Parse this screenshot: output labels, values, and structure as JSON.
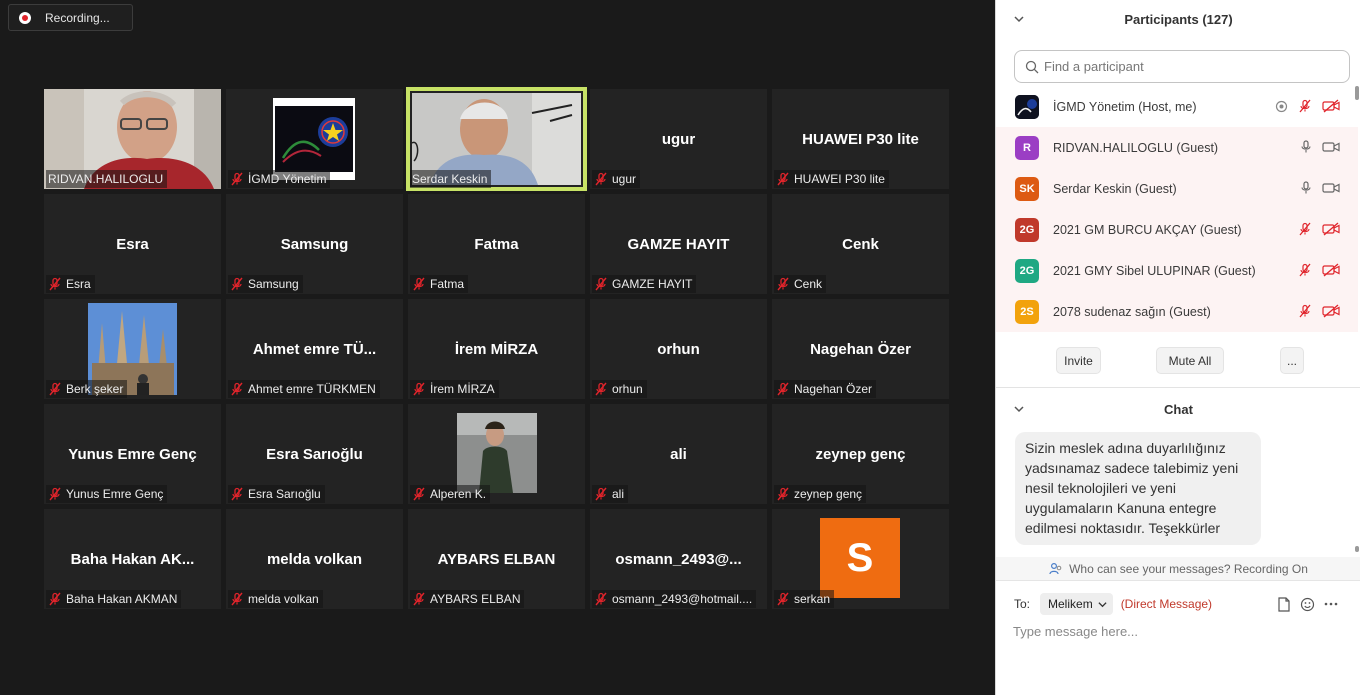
{
  "recording": {
    "label": "Recording..."
  },
  "tiles": [
    {
      "title": "",
      "label": "RIDVAN.HALILOGLU",
      "muted": false,
      "media": "photo-man-glasses",
      "active": false
    },
    {
      "title": "",
      "label": "İGMD Yönetim",
      "muted": true,
      "media": "logo",
      "active": false
    },
    {
      "title": "",
      "label": "Serdar Keskin",
      "muted": false,
      "media": "photo-man-speaking",
      "active": true
    },
    {
      "title": "ugur",
      "label": "ugur",
      "muted": true,
      "media": "",
      "active": false
    },
    {
      "title": "HUAWEI P30 lite",
      "label": "HUAWEI P30 lite",
      "muted": true,
      "media": "",
      "active": false
    },
    {
      "title": "Esra",
      "label": "Esra",
      "muted": true,
      "media": "",
      "active": false
    },
    {
      "title": "Samsung",
      "label": "Samsung",
      "muted": true,
      "media": "",
      "active": false
    },
    {
      "title": "Fatma",
      "label": "Fatma",
      "muted": true,
      "media": "",
      "active": false
    },
    {
      "title": "GAMZE HAYIT",
      "label": "GAMZE HAYIT",
      "muted": true,
      "media": "",
      "active": false
    },
    {
      "title": "Cenk",
      "label": "Cenk",
      "muted": true,
      "media": "",
      "active": false
    },
    {
      "title": "",
      "label": "Berk şeker",
      "muted": true,
      "media": "photo-cathedral",
      "active": false
    },
    {
      "title": "Ahmet emre TÜ...",
      "label": "Ahmet emre TÜRKMEN",
      "muted": true,
      "media": "",
      "active": false
    },
    {
      "title": "İrem MİRZA",
      "label": "İrem MİRZA",
      "muted": true,
      "media": "",
      "active": false
    },
    {
      "title": "orhun",
      "label": "orhun",
      "muted": true,
      "media": "",
      "active": false
    },
    {
      "title": "Nagehan Özer",
      "label": "Nagehan Özer",
      "muted": true,
      "media": "",
      "active": false
    },
    {
      "title": "Yunus Emre Genç",
      "label": "Yunus Emre Genç",
      "muted": true,
      "media": "",
      "active": false
    },
    {
      "title": "Esra Sarıoğlu",
      "label": "Esra Sarıoğlu",
      "muted": true,
      "media": "",
      "active": false
    },
    {
      "title": "",
      "label": "Alperen K.",
      "muted": true,
      "media": "photo-young-man",
      "active": false
    },
    {
      "title": "ali",
      "label": "ali",
      "muted": true,
      "media": "",
      "active": false
    },
    {
      "title": "zeynep genç",
      "label": "zeynep genç",
      "muted": true,
      "media": "",
      "active": false
    },
    {
      "title": "Baha Hakan AK...",
      "label": "Baha Hakan AKMAN",
      "muted": true,
      "media": "",
      "active": false
    },
    {
      "title": "melda volkan",
      "label": "melda volkan",
      "muted": true,
      "media": "",
      "active": false
    },
    {
      "title": "AYBARS ELBAN",
      "label": "AYBARS ELBAN",
      "muted": true,
      "media": "",
      "active": false
    },
    {
      "title": "osmann_2493@...",
      "label": "osmann_2493@hotmail....",
      "muted": true,
      "media": "",
      "active": false
    },
    {
      "title": "",
      "label": "serkan",
      "muted": true,
      "media": "avatar-s",
      "avatar_letter": "S",
      "active": false
    }
  ],
  "participants": {
    "header": "Participants (127)",
    "search_placeholder": "Find a participant",
    "list": [
      {
        "name": "İGMD Yönetim (Host, me)",
        "avatar_text": "",
        "avatar_color": "#101828",
        "avatar_type": "logo",
        "mic": "muted",
        "video": "off",
        "recording_icon": true,
        "guest": false
      },
      {
        "name": "RIDVAN.HALILOGLU (Guest)",
        "avatar_text": "R",
        "avatar_color": "#9b3ec4",
        "mic": "on",
        "video": "on",
        "guest": true
      },
      {
        "name": "Serdar Keskin (Guest)",
        "avatar_text": "SK",
        "avatar_color": "#dd5a12",
        "mic": "on",
        "video": "on",
        "guest": true
      },
      {
        "name": "2021 GM BURCU AKÇAY (Guest)",
        "avatar_text": "2G",
        "avatar_color": "#c0392b",
        "mic": "muted",
        "video": "off",
        "guest": true
      },
      {
        "name": "2021 GMY Sibel ULUPINAR (Guest)",
        "avatar_text": "2G",
        "avatar_color": "#1fa883",
        "mic": "muted",
        "video": "off",
        "guest": true
      },
      {
        "name": "2078 sudenaz sağın (Guest)",
        "avatar_text": "2S",
        "avatar_color": "#f2a20c",
        "mic": "muted",
        "video": "off",
        "guest": true
      }
    ],
    "buttons": {
      "invite": "Invite",
      "mute_all": "Mute All",
      "more": "..."
    }
  },
  "chat": {
    "header": "Chat",
    "message": "Sizin meslek adına duyarlılığınız yadsınamaz sadece talebimiz yeni nesil teknolojileri ve yeni uygulamaların Kanuna entegre edilmesi noktasıdır. Teşekkürler",
    "privacy_note": "Who can see your messages? Recording On",
    "to_label": "To:",
    "recipient": "Melikem",
    "dm_label": "(Direct Message)",
    "input_placeholder": "Type message here..."
  },
  "colors": {
    "active_border": "#c7e266",
    "tile_bg": "#232323",
    "mute_red": "#e0242b",
    "panel_bg": "#ffffff",
    "guest_row_bg": "#fdf3f3"
  }
}
